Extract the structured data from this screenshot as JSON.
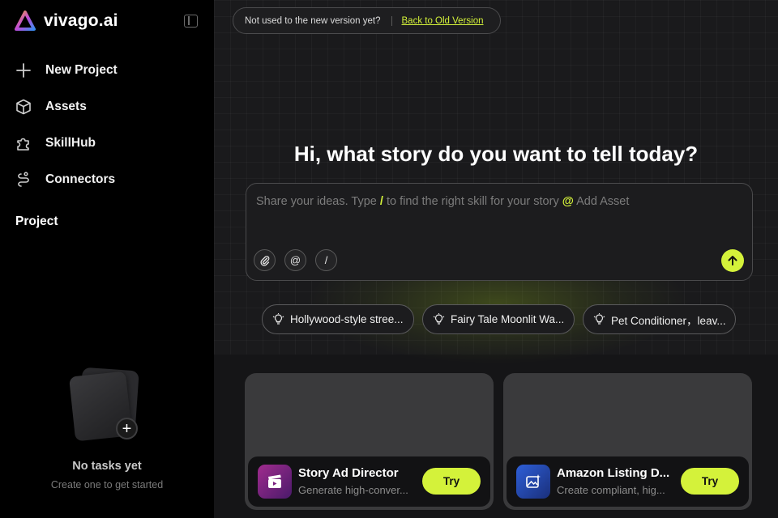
{
  "brand": {
    "name": "vivago.ai",
    "logo_icon": "triangle-logo-icon"
  },
  "sidebar": {
    "nav": [
      {
        "label": "New Project",
        "icon": "plus-icon"
      },
      {
        "label": "Assets",
        "icon": "cube-icon"
      },
      {
        "label": "SkillHub",
        "icon": "puzzle-icon"
      },
      {
        "label": "Connectors",
        "icon": "link-icon"
      }
    ],
    "project_heading": "Project",
    "empty_state": {
      "title": "No tasks yet",
      "subtitle": "Create one to get started"
    }
  },
  "notice": {
    "text": "Not used to the new version yet?",
    "link": "Back to Old Version"
  },
  "headline": "Hi, what story do you want to tell today?",
  "prompt": {
    "placeholder_a": "Share your ideas. Type ",
    "slash": "/",
    "placeholder_b": " to find the right skill for your story ",
    "at": "@",
    "placeholder_c": " Add Asset",
    "tools": [
      {
        "icon": "paperclip-icon"
      },
      {
        "label": "@",
        "icon": "at-icon"
      },
      {
        "label": "/",
        "icon": "slash-icon"
      }
    ],
    "send_icon": "arrow-up-icon"
  },
  "chips": [
    {
      "label": "Hollywood-style stree...",
      "icon": "lightbulb-icon"
    },
    {
      "label": "Fairy Tale Moonlit Wa...",
      "icon": "lightbulb-icon"
    },
    {
      "label": "Pet Conditioner，leav...",
      "icon": "lightbulb-icon"
    }
  ],
  "features": [
    {
      "title": "Story Ad Director",
      "subtitle": "Generate high-conver...",
      "button": "Try",
      "icon": "clapperboard-icon"
    },
    {
      "title": "Amazon Listing D...",
      "subtitle": "Create compliant, hig...",
      "button": "Try",
      "icon": "image-sparkle-icon"
    }
  ],
  "colors": {
    "accent": "#d4f23a",
    "sidebar_bg": "#000000",
    "main_bg": "#1a1a1c"
  }
}
